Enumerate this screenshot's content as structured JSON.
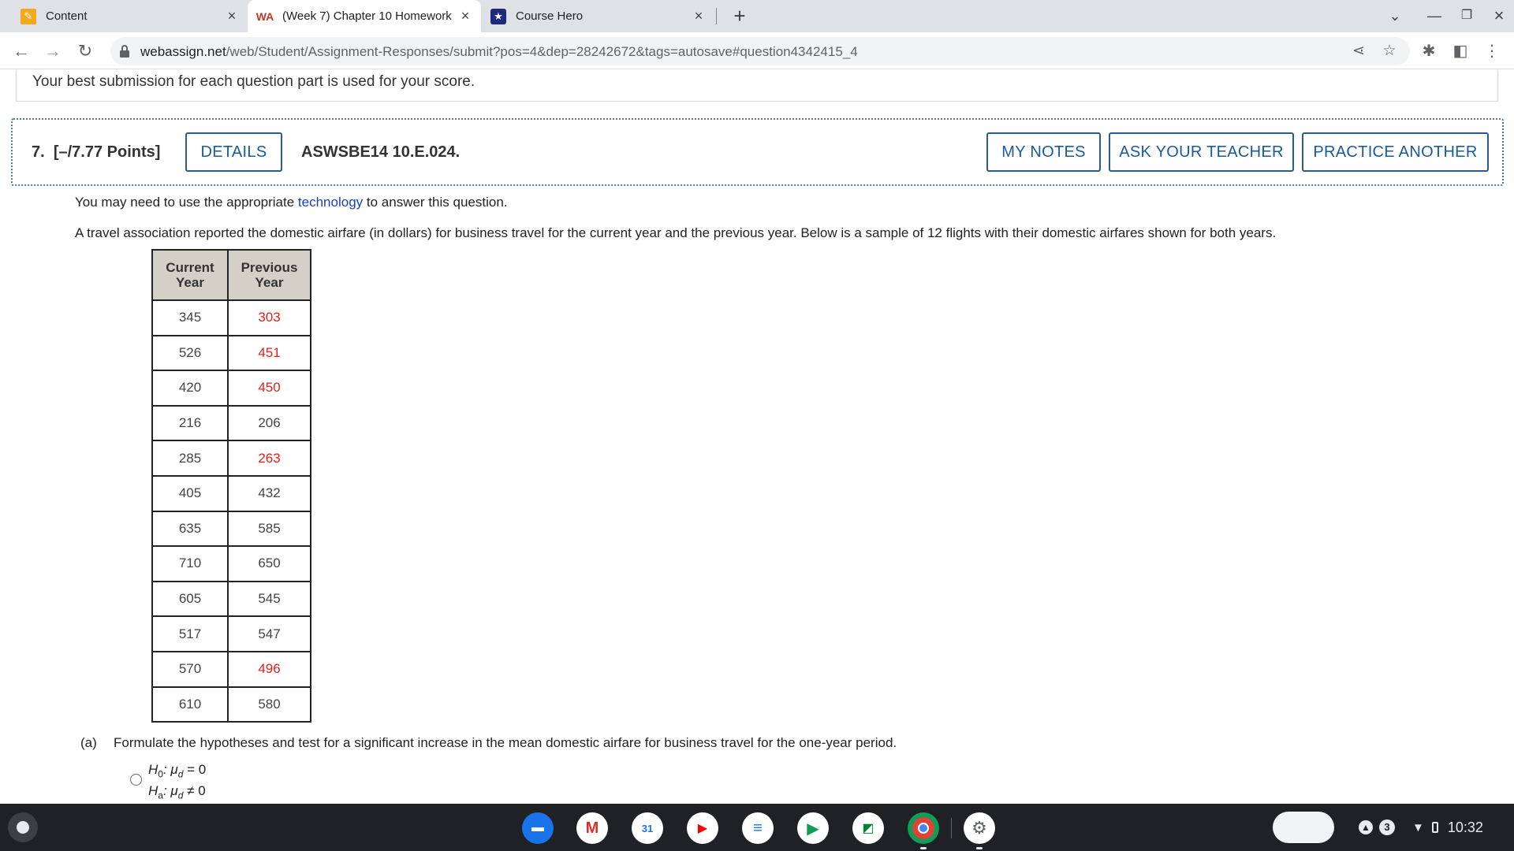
{
  "browser": {
    "tabs": [
      {
        "title": "Content",
        "icon": "pencil-icon"
      },
      {
        "title": "(Week 7) Chapter 10 Homework",
        "icon": "webassign-icon"
      },
      {
        "title": "Course Hero",
        "icon": "star-icon"
      }
    ],
    "new_tab": "+",
    "url_host": "webassign.net",
    "url_path": "/web/Student/Assignment-Responses/submit?pos=4&dep=28242672&tags=autosave#question4342415_4"
  },
  "page": {
    "best_submission_text": "Your best submission for each question part is used for your score.",
    "question": {
      "number": "7.",
      "points": "[–/7.77 Points]",
      "details_label": "DETAILS",
      "code": "ASWSBE14 10.E.024.",
      "my_notes_label": "MY NOTES",
      "ask_teacher_label": "ASK YOUR TEACHER",
      "practice_label": "PRACTICE ANOTHER"
    },
    "tech_prefix": "You may need to use the appropriate",
    "tech_link": "technology",
    "tech_suffix": "to answer this question.",
    "intro": "A travel association reported the domestic airfare (in dollars) for business travel for the current year and the previous year. Below is a sample of 12 flights with their domestic airfares shown for both years.",
    "table": {
      "headers": [
        {
          "line1": "Current",
          "line2": "Year"
        },
        {
          "line1": "Previous",
          "line2": "Year"
        }
      ],
      "rows": [
        [
          "345",
          "303"
        ],
        [
          "526",
          "451"
        ],
        [
          "420",
          "450"
        ],
        [
          "216",
          "206"
        ],
        [
          "285",
          "263"
        ],
        [
          "405",
          "432"
        ],
        [
          "635",
          "585"
        ],
        [
          "710",
          "650"
        ],
        [
          "605",
          "545"
        ],
        [
          "517",
          "547"
        ],
        [
          "570",
          "496"
        ],
        [
          "610",
          "580"
        ]
      ]
    },
    "part_a_label": "(a)",
    "part_a_text": "Formulate the hypotheses and test for a significant increase in the mean domestic airfare for business travel for the one-year period.",
    "option1": {
      "h0_var": "H",
      "h0_sub": "0",
      "h0_rel": ": μ",
      "h0_rel_sub": "d",
      "h0_rhs": " = 0",
      "ha_var": "H",
      "ha_sub": "a",
      "ha_rel": ": μ",
      "ha_rel_sub": "d",
      "ha_rhs": " ≠ 0"
    }
  },
  "shelf": {
    "notification_count": "3",
    "time": "10:32"
  },
  "colors": {
    "accent_blue": "#1a5a9a",
    "highlight_red": "#e0211b",
    "header_gray": "#d4d0c8"
  }
}
